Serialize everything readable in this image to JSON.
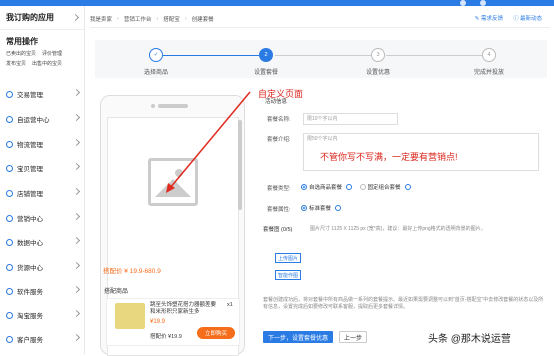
{
  "sidebar": {
    "title": "我订购的应用",
    "common_heading": "常用操作",
    "common_links": [
      [
        "已卖出的宝贝",
        "评价管理"
      ],
      [
        "发布宝贝",
        "出售中的宝贝"
      ]
    ],
    "items": [
      {
        "label": "交易管理"
      },
      {
        "label": "自运营中心"
      },
      {
        "label": "物流管理"
      },
      {
        "label": "宝贝管理"
      },
      {
        "label": "店铺管理"
      },
      {
        "label": "营销中心"
      },
      {
        "label": "数据中心"
      },
      {
        "label": "货源中心"
      },
      {
        "label": "软件服务"
      },
      {
        "label": "淘宝服务"
      },
      {
        "label": "客户服务"
      }
    ]
  },
  "breadcrumb": {
    "items": [
      "我是卖家",
      "营销工作台",
      "搭配宝",
      "创建套餐"
    ],
    "feedback": "需求反馈",
    "latest": "最新动态"
  },
  "steps": [
    {
      "label": "选择商品",
      "num": "✓",
      "state": "done"
    },
    {
      "label": "设置套餐",
      "num": "2",
      "state": "active"
    },
    {
      "label": "设置优惠",
      "num": "3",
      "state": "pending"
    },
    {
      "label": "完成并投放",
      "num": "4",
      "state": "pending"
    }
  ],
  "preview": {
    "price": "搭配价 ¥ 19.9-680.9",
    "combo_heading": "搭配商品",
    "product_name": "跳至头饰塑花搭力器额差要和米形积只家新生多",
    "product_qty": "x1",
    "product_price": "¥19.9",
    "combo_price": "搭配价 ¥19.9",
    "buy": "立即购买"
  },
  "form": {
    "section": "活动信息",
    "name_label": "套餐名称:",
    "name_placeholder": "限10个字以内",
    "intro_label": "套餐介绍:",
    "intro_placeholder": "限50个字以内",
    "type_label": "套餐类型:",
    "type_options": [
      "自选商品套餐",
      "固定组合套餐"
    ],
    "attr_label": "套餐属性:",
    "attr_option": "标准套餐",
    "image_label": "套餐图",
    "image_count": "(0/5)",
    "image_tip": "图片尺寸 1125 X 1125 px (宽*高)，建议：最好上传png格式的透明背景的图片。",
    "upload": "上传图片",
    "smart": "智能作图",
    "note": "套餐创建成功后，将对套餐中所有商品做一系列的套餐提示。最近如果需要调整可以到\"首页-搭配宝\"中去修改套餐的状态以及所有信息，设置完成后如要修改可联系客服，提取后更多套餐详情。",
    "next": "下一步，设置套餐优惠",
    "prev": "上一步"
  },
  "annotations": {
    "custom_page": "自定义页面",
    "selling_point": "不管你写不写满，一定要有营销点!"
  },
  "watermark": "头条 @那木说运营"
}
